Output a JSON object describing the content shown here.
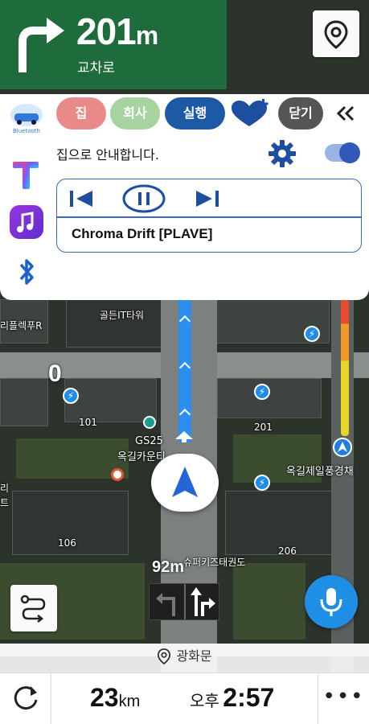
{
  "turn_banner": {
    "distance_value": "201",
    "distance_unit": "m",
    "road_name": "교차로",
    "bg_color": "#1e6b3c",
    "icon": "turn-right-arrow-icon"
  },
  "panel": {
    "chips": {
      "home": "집",
      "work": "회사",
      "run": "실행",
      "close": "닫기"
    },
    "guide_text": "집으로 안내합니다.",
    "toggle_on": true,
    "side_icons": [
      "bluetooth-car-icon",
      "t-app-icon",
      "music-app-icon",
      "bluetooth-icon"
    ],
    "side_icon_caption": "Bluetooth",
    "player": {
      "track_title": "Chroma Drift [PLAVE]",
      "state": "playing"
    },
    "accent_color": "#1d5aa6"
  },
  "map": {
    "labels": {
      "building_it": "골든IT타워",
      "left_edge": "리플렉푸R",
      "bldg_101": "101",
      "bldg_201": "201",
      "bldg_106": "106",
      "bldg_206": "206",
      "gs25_line1": "GS25",
      "gs25_line2": "옥길카운티",
      "okgil_ele": "옥길제일풍경채",
      "taekwondo": "슈퍼키즈태권도",
      "left_cut_1": "리",
      "left_cut_2": "트",
      "zero": "0"
    },
    "route_color": "#2b8ef0"
  },
  "lane_guide": {
    "distance": "92m"
  },
  "current_road": "광화문",
  "bottom_bar": {
    "remaining_value": "23",
    "remaining_unit": "km",
    "eta_ampm": "오후",
    "eta_time": "2:57",
    "more": "•••"
  }
}
